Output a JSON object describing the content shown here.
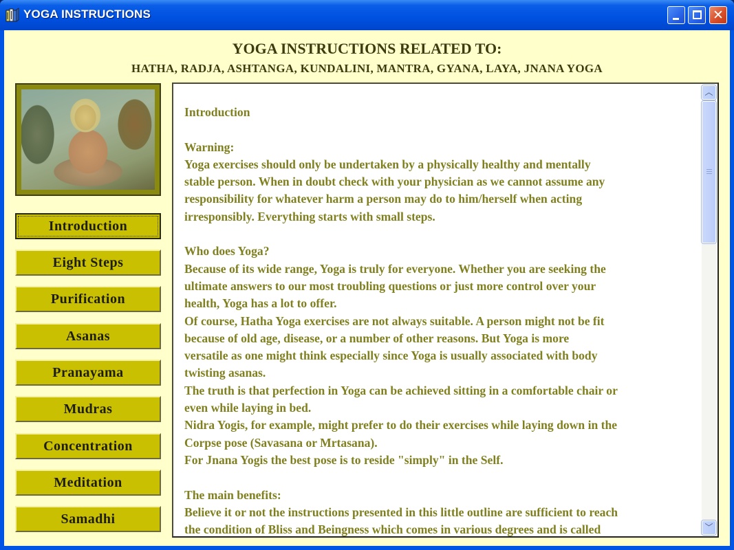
{
  "window": {
    "title": "YOGA INSTRUCTIONS",
    "icon": "book-icon",
    "controls": {
      "minimize": "minimize-icon",
      "maximize": "maximize-icon",
      "close": "close-icon"
    }
  },
  "header": {
    "title": "YOGA INSTRUCTIONS RELATED TO:",
    "subtitle": "HATHA, RADJA, ASHTANGA, KUNDALINI, MANTRA, GYANA, LAYA, JNANA YOGA"
  },
  "image": {
    "description": "Seated Buddha painting"
  },
  "nav": {
    "active": "Introduction",
    "items": [
      {
        "label": "Introduction"
      },
      {
        "label": "Eight Steps"
      },
      {
        "label": "Purification"
      },
      {
        "label": "Asanas"
      },
      {
        "label": "Pranayama"
      },
      {
        "label": "Mudras"
      },
      {
        "label": "Concentration"
      },
      {
        "label": "Meditation"
      },
      {
        "label": "Samadhi"
      }
    ]
  },
  "content": {
    "lines": [
      "Introduction",
      "",
      "Warning:",
      "Yoga exercises should only be undertaken by a physically healthy and mentally",
      "stable person. When in doubt check with your physician as we cannot assume any",
      "responsibility for whatever harm a person may do to him/herself when acting",
      "irresponsibly. Everything starts with small steps.",
      "",
      "Who does Yoga?",
      "Because of its wide range, Yoga is truly for everyone. Whether you are seeking the",
      "ultimate answers to our most troubling questions or just more control over your",
      "health, Yoga has a lot to offer.",
      "Of course, Hatha Yoga exercises are not always suitable. A person might not be fit",
      "because of old age, disease, or a number of other reasons. But Yoga is more",
      "versatile as one might think especially since Yoga is usually associated with body",
      "twisting asanas.",
      "The truth is that perfection in Yoga can be achieved sitting in a comfortable chair or",
      "even while laying in bed.",
      "Nidra Yogis, for example, might prefer to do their exercises while laying down in the",
      "Corpse pose (Savasana or Mrtasana).",
      "For Jnana Yogis the best pose is to reside \"simply\" in the Self.",
      "",
      "The main benefits:",
      "Believe it or not the instructions presented in this little outline are sufficient to reach",
      "the condition of Bliss and Beingness which comes in various degrees and is called"
    ]
  },
  "scrollbar": {
    "position_fraction": 0.0,
    "visible_fraction": 0.33
  },
  "colors": {
    "background": "#ffffcc",
    "button": "#c8c000",
    "text": "#808020",
    "titlebar": "#0050e0"
  }
}
